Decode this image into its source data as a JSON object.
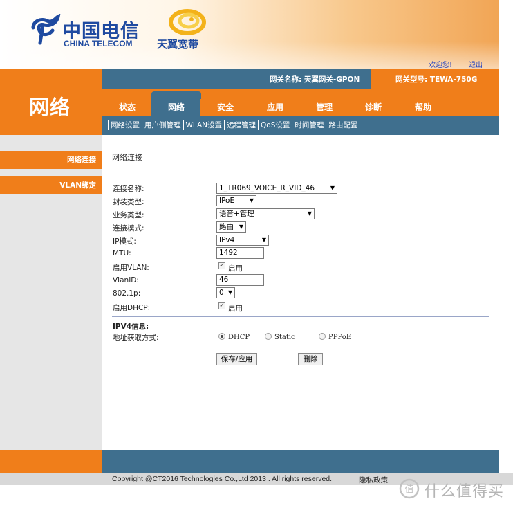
{
  "header": {
    "brand_cn": "中国电信",
    "brand_en": "CHINA TELECOM",
    "sub_brand": "天翼宽带",
    "welcome": "欢迎您!",
    "logout": "退出"
  },
  "section_title": "网络",
  "gateway": {
    "name": "网关名称:  天翼网关-GPON",
    "model": "网关型号:  TEWA-750G"
  },
  "nav": {
    "tabs": [
      "状态",
      "网络",
      "安全",
      "应用",
      "管理",
      "诊断",
      "帮助"
    ],
    "active": "网络"
  },
  "subnav": [
    "网络设置",
    "用户侧管理",
    "WLAN设置",
    "远程管理",
    "QoS设置",
    "时间管理",
    "路由配置"
  ],
  "sidebar": {
    "items": [
      "网络连接",
      "VLAN绑定"
    ]
  },
  "content": {
    "title": "网络连接",
    "fields": {
      "conn_name": {
        "label": "连接名称:",
        "value": "1_TR069_VOICE_R_VID_46"
      },
      "encap": {
        "label": "封装类型:",
        "value": "IPoE"
      },
      "service": {
        "label": "业务类型:",
        "value": "语音+管理"
      },
      "conn_mode": {
        "label": "连接模式:",
        "value": "路由"
      },
      "ip_mode": {
        "label": "IP模式:",
        "value": "IPv4"
      },
      "mtu": {
        "label": "MTU:",
        "value": "1492"
      },
      "enable_vlan": {
        "label": "启用VLAN:",
        "checked": true,
        "text": "启用"
      },
      "vlan_id": {
        "label": "VlanID:",
        "value": "46"
      },
      "dot1p": {
        "label": "802.1p:",
        "value": "0"
      },
      "enable_dhcp": {
        "label": "启用DHCP:",
        "checked": true,
        "text": "启用"
      }
    },
    "ipv4_section": "IPV4信息:",
    "addr_mode": {
      "label": "地址获取方式:",
      "options": [
        "DHCP",
        "Static",
        "PPPoE"
      ],
      "selected": "DHCP"
    },
    "buttons": {
      "save": "保存/应用",
      "delete": "删除"
    }
  },
  "footer": {
    "copyright": "Copyright @CT2016 Technologies Co.,Ltd 2013 . All rights reserved.",
    "privacy": "隐私政策"
  },
  "watermark": "什么值得买",
  "colors": {
    "orange": "#f07e1a",
    "blue": "#3f6f8e"
  }
}
